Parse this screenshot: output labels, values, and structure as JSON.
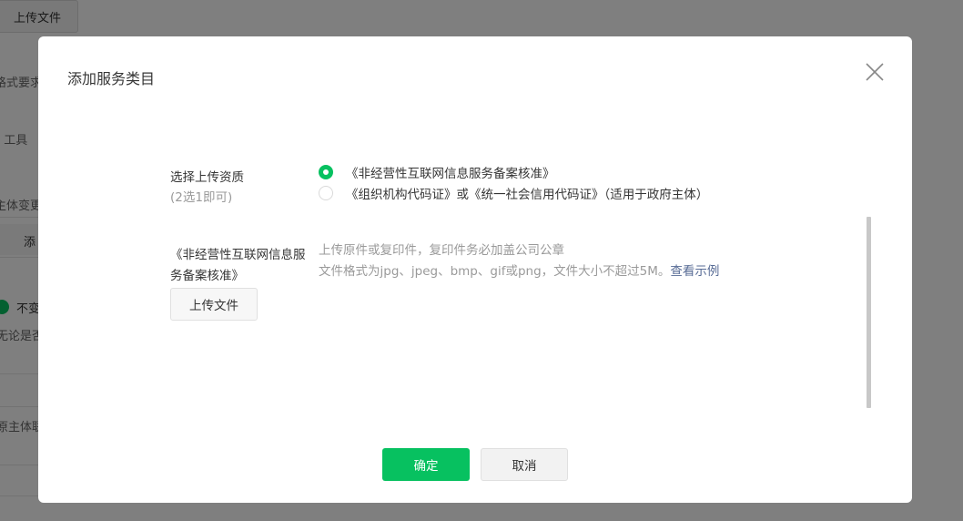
{
  "background": {
    "upload_button": "上传文件",
    "fragments": [
      "格式要求",
      ". 工具",
      "主体变更",
      "添",
      "不变",
      "无论是否",
      "原主体联"
    ]
  },
  "dialog": {
    "title": "添加服务类目",
    "qualification": {
      "label": "选择上传资质",
      "sublabel": "(2选1即可)",
      "options": [
        {
          "label": "《非经营性互联网信息服务备案核准》",
          "checked": true
        },
        {
          "label": "《组织机构代码证》或《统一社会信用代码证》（适用于政府主体）",
          "checked": false
        }
      ]
    },
    "upload": {
      "label": "《非经营性互联网信息服务备案核准》",
      "button": "上传文件",
      "hint_line1": "上传原件或复印件，复印件务必加盖公司公章",
      "hint_line2": "文件格式为jpg、jpeg、bmp、gif或png，文件大小不超过5M。",
      "example_link": "查看示例"
    },
    "confirm_button": "确定",
    "cancel_button": "取消"
  },
  "colors": {
    "primary": "#07c160",
    "link": "#576b95",
    "overlay": "rgba(0,0,0,0.5)"
  },
  "icons": {
    "close": "close-icon",
    "radio": "radio-icon"
  }
}
